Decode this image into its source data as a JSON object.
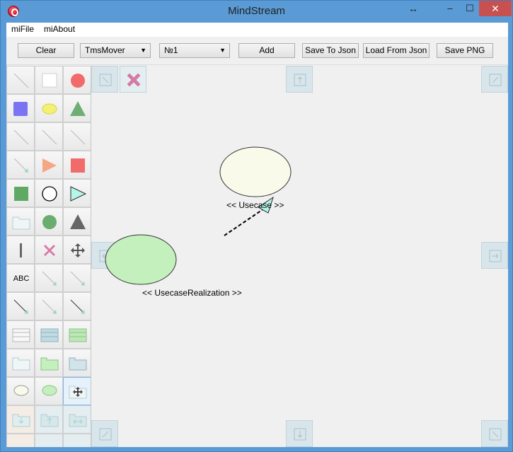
{
  "window": {
    "title": "MindStream",
    "buttons": {
      "resize": "↔",
      "minimize": "–",
      "maximize": "☐",
      "close": "✕"
    }
  },
  "menu": {
    "items": [
      "miFile",
      "miAbout"
    ]
  },
  "toolbar": {
    "clear": "Clear",
    "mover_select": "TmsMover",
    "number_select": "№1",
    "add": "Add",
    "save_json": "Save To Json",
    "load_json": "Load From Json",
    "save_png": "Save PNG"
  },
  "palette": {
    "text_tool": "ABC",
    "tools": [
      "line-tool",
      "rectangle-tool",
      "circle-tool",
      "square-tool",
      "ellipse-tool",
      "triangle-tool",
      "line-tool-2",
      "line-tool-3",
      "line-tool-4",
      "arrow-line-tool",
      "right-triangle-tool",
      "red-square-tool",
      "green-square-tool",
      "circle-outline-tool",
      "cyan-triangle-tool",
      "folder-tool",
      "green-circle-tool",
      "gray-triangle-tool",
      "vertical-line-tool",
      "delete-tool",
      "move-tool",
      "text-tool",
      "arrow-line-tool-2",
      "arrow-line-tool-3",
      "dark-arrow-tool",
      "arrow-line-tool-4",
      "dark-arrow-tool-2",
      "class-tool",
      "class-blue-tool",
      "class-green-tool",
      "package-tool",
      "package-green-tool",
      "package-blue-tool",
      "usecase-tool",
      "usecase-realization-tool",
      "package-move-tool",
      "package-down-tool",
      "package-up-tool",
      "package-both-tool"
    ]
  },
  "diagram": {
    "usecase_label": "<< Usecase >>",
    "realization_label": "<< UsecaseRealization >>",
    "colors": {
      "usecase_fill": "#fafaeb",
      "realization_fill": "#c3f0bd",
      "arrow_head_fill": "#b5f5ea"
    }
  }
}
